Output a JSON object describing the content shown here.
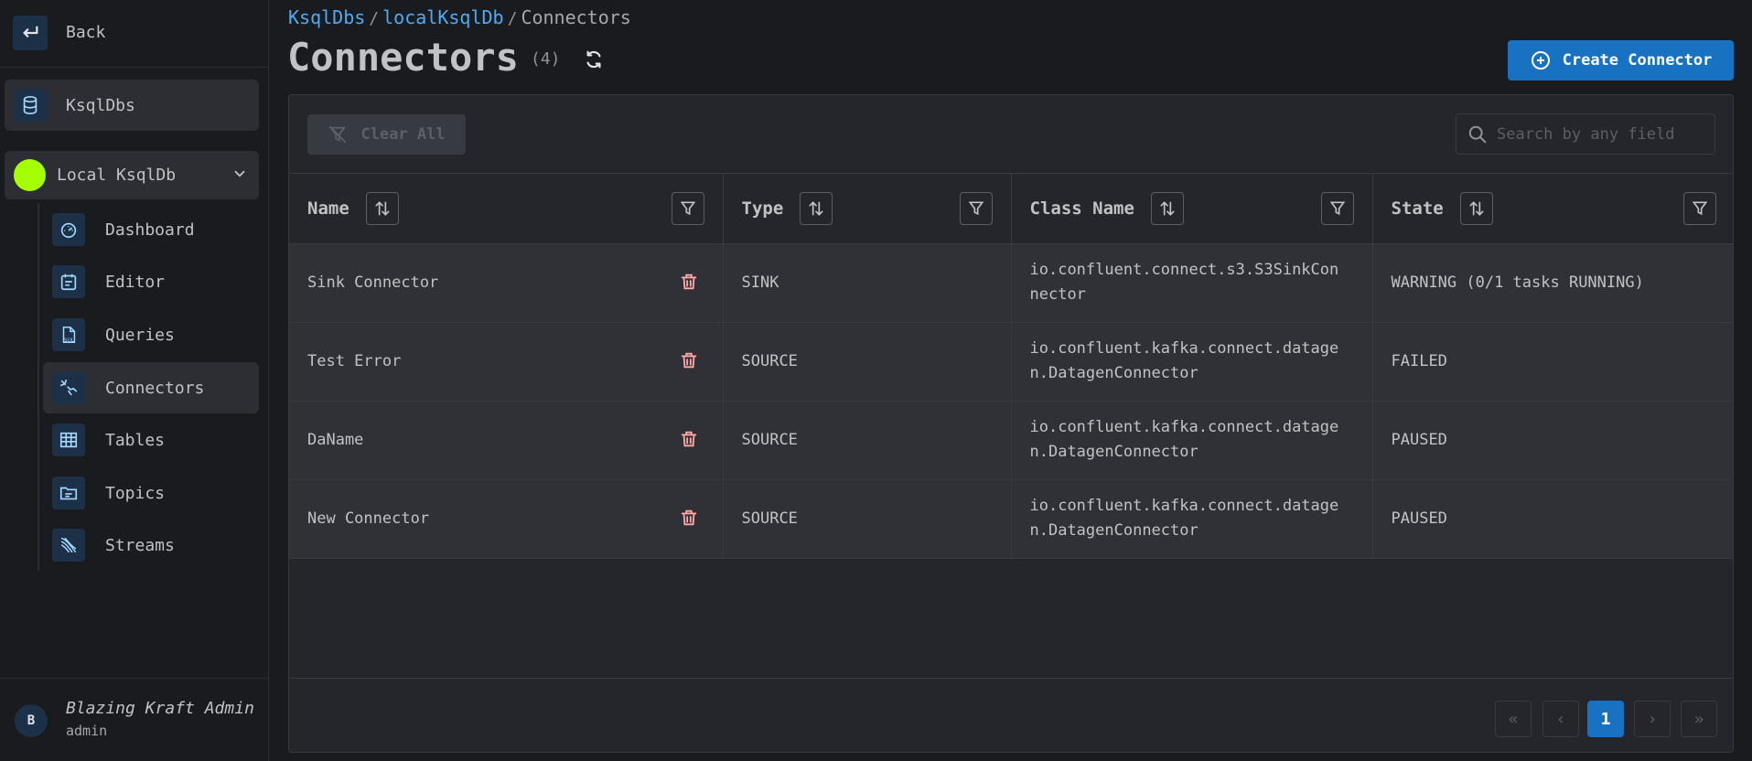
{
  "sidebar": {
    "back_label": "Back",
    "ksqldbs_label": "KsqlDbs",
    "local_label": "Local KsqlDb",
    "local_color": "#a6ff00",
    "items": [
      {
        "label": "Dashboard",
        "icon": "gauge-icon"
      },
      {
        "label": "Editor",
        "icon": "editor-icon"
      },
      {
        "label": "Queries",
        "icon": "sql-file-icon"
      },
      {
        "label": "Connectors",
        "icon": "plug-icon"
      },
      {
        "label": "Tables",
        "icon": "table-icon"
      },
      {
        "label": "Topics",
        "icon": "folder-icon"
      },
      {
        "label": "Streams",
        "icon": "streams-icon"
      }
    ],
    "active_item": "Connectors",
    "user": {
      "initial": "B",
      "name": "Blazing Kraft Admin",
      "role": "admin"
    }
  },
  "breadcrumb": {
    "root": "KsqlDbs",
    "middle": "localKsqlDb",
    "current": "Connectors",
    "separator": "/"
  },
  "header": {
    "title": "Connectors",
    "count": "(4)",
    "create_label": "Create Connector"
  },
  "toolbar": {
    "clear_label": "Clear All",
    "search_placeholder": "Search by any field"
  },
  "table": {
    "columns": [
      "Name",
      "Type",
      "Class Name",
      "State"
    ],
    "rows": [
      {
        "name": "Sink Connector",
        "type": "SINK",
        "class_name": "io.confluent.connect.s3.S3SinkCon\nnector",
        "state": "WARNING (0/1 tasks RUNNING)"
      },
      {
        "name": "Test Error",
        "type": "SOURCE",
        "class_name": "io.confluent.kafka.connect.datage\nn.DatagenConnector",
        "state": "FAILED"
      },
      {
        "name": "DaName",
        "type": "SOURCE",
        "class_name": "io.confluent.kafka.connect.datage\nn.DatagenConnector",
        "state": "PAUSED"
      },
      {
        "name": "New Connector",
        "type": "SOURCE",
        "class_name": "io.confluent.kafka.connect.datage\nn.DatagenConnector",
        "state": "PAUSED"
      }
    ]
  },
  "pagination": {
    "current": "1",
    "first": "«",
    "prev": "‹",
    "next": "›",
    "last": "»"
  },
  "colors": {
    "accent": "#1971c2",
    "link": "#4dabf7",
    "danger": "#ffa8a8"
  }
}
